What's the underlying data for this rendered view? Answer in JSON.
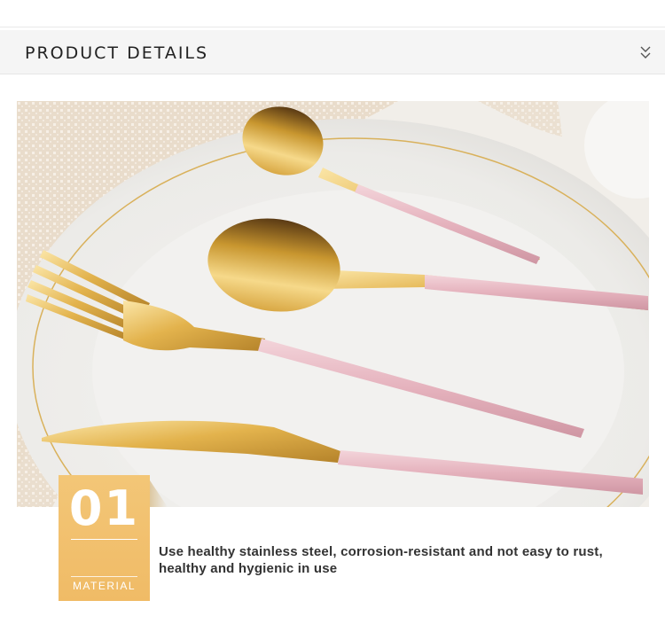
{
  "section": {
    "title": "PRODUCT DETAILS"
  },
  "feature": {
    "number": "01",
    "label": "MATERIAL",
    "description": "Use healthy stainless steel, corrosion-resistant and not easy to rust, healthy and hygienic in use"
  },
  "colors": {
    "gold": "#e2b14a",
    "pink": "#e7b9c2",
    "badge": "#f0bb66"
  }
}
